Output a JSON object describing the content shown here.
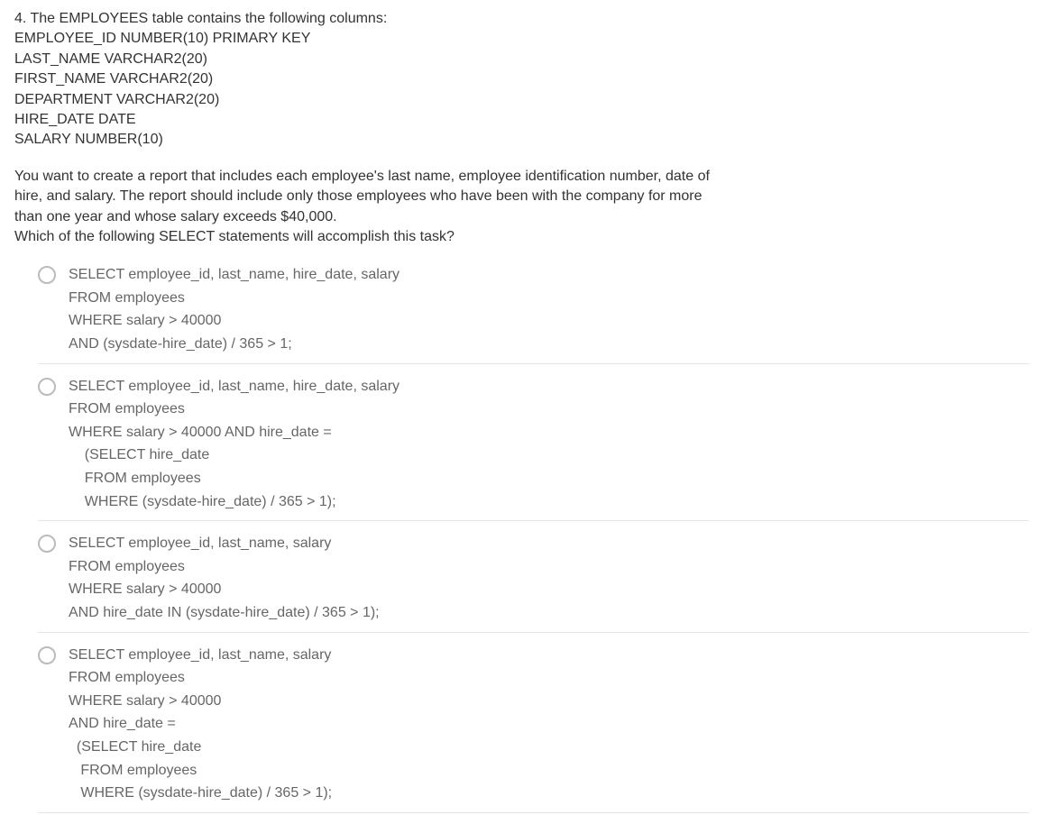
{
  "question": {
    "number": "4.",
    "intro_lines": [
      "4. The EMPLOYEES table contains the following columns:",
      "EMPLOYEE_ID NUMBER(10) PRIMARY KEY",
      "LAST_NAME VARCHAR2(20)",
      "FIRST_NAME VARCHAR2(20)",
      "DEPARTMENT VARCHAR2(20)",
      "HIRE_DATE DATE",
      "SALARY NUMBER(10)"
    ],
    "body_lines": [
      "You want to create a report that includes each employee's last name, employee identification number, date of",
      "hire, and salary. The report should include only those employees who have been with the company for more",
      "than one year and whose salary exceeds $40,000.",
      "Which of the following SELECT statements will accomplish this task?"
    ]
  },
  "options": [
    {
      "text": "SELECT employee_id, last_name, hire_date, salary\nFROM employees\nWHERE salary > 40000\nAND (sysdate-hire_date) / 365 > 1;"
    },
    {
      "text": "SELECT employee_id, last_name, hire_date, salary\nFROM employees\nWHERE salary > 40000 AND hire_date =\n    (SELECT hire_date\n    FROM employees\n    WHERE (sysdate-hire_date) / 365 > 1);"
    },
    {
      "text": "SELECT employee_id, last_name, salary\nFROM employees\nWHERE salary > 40000\nAND hire_date IN (sysdate-hire_date) / 365 > 1);"
    },
    {
      "text": "SELECT employee_id, last_name, salary\nFROM employees\nWHERE salary > 40000\nAND hire_date =\n  (SELECT hire_date\n   FROM employees\n   WHERE (sysdate-hire_date) / 365 > 1);"
    }
  ]
}
